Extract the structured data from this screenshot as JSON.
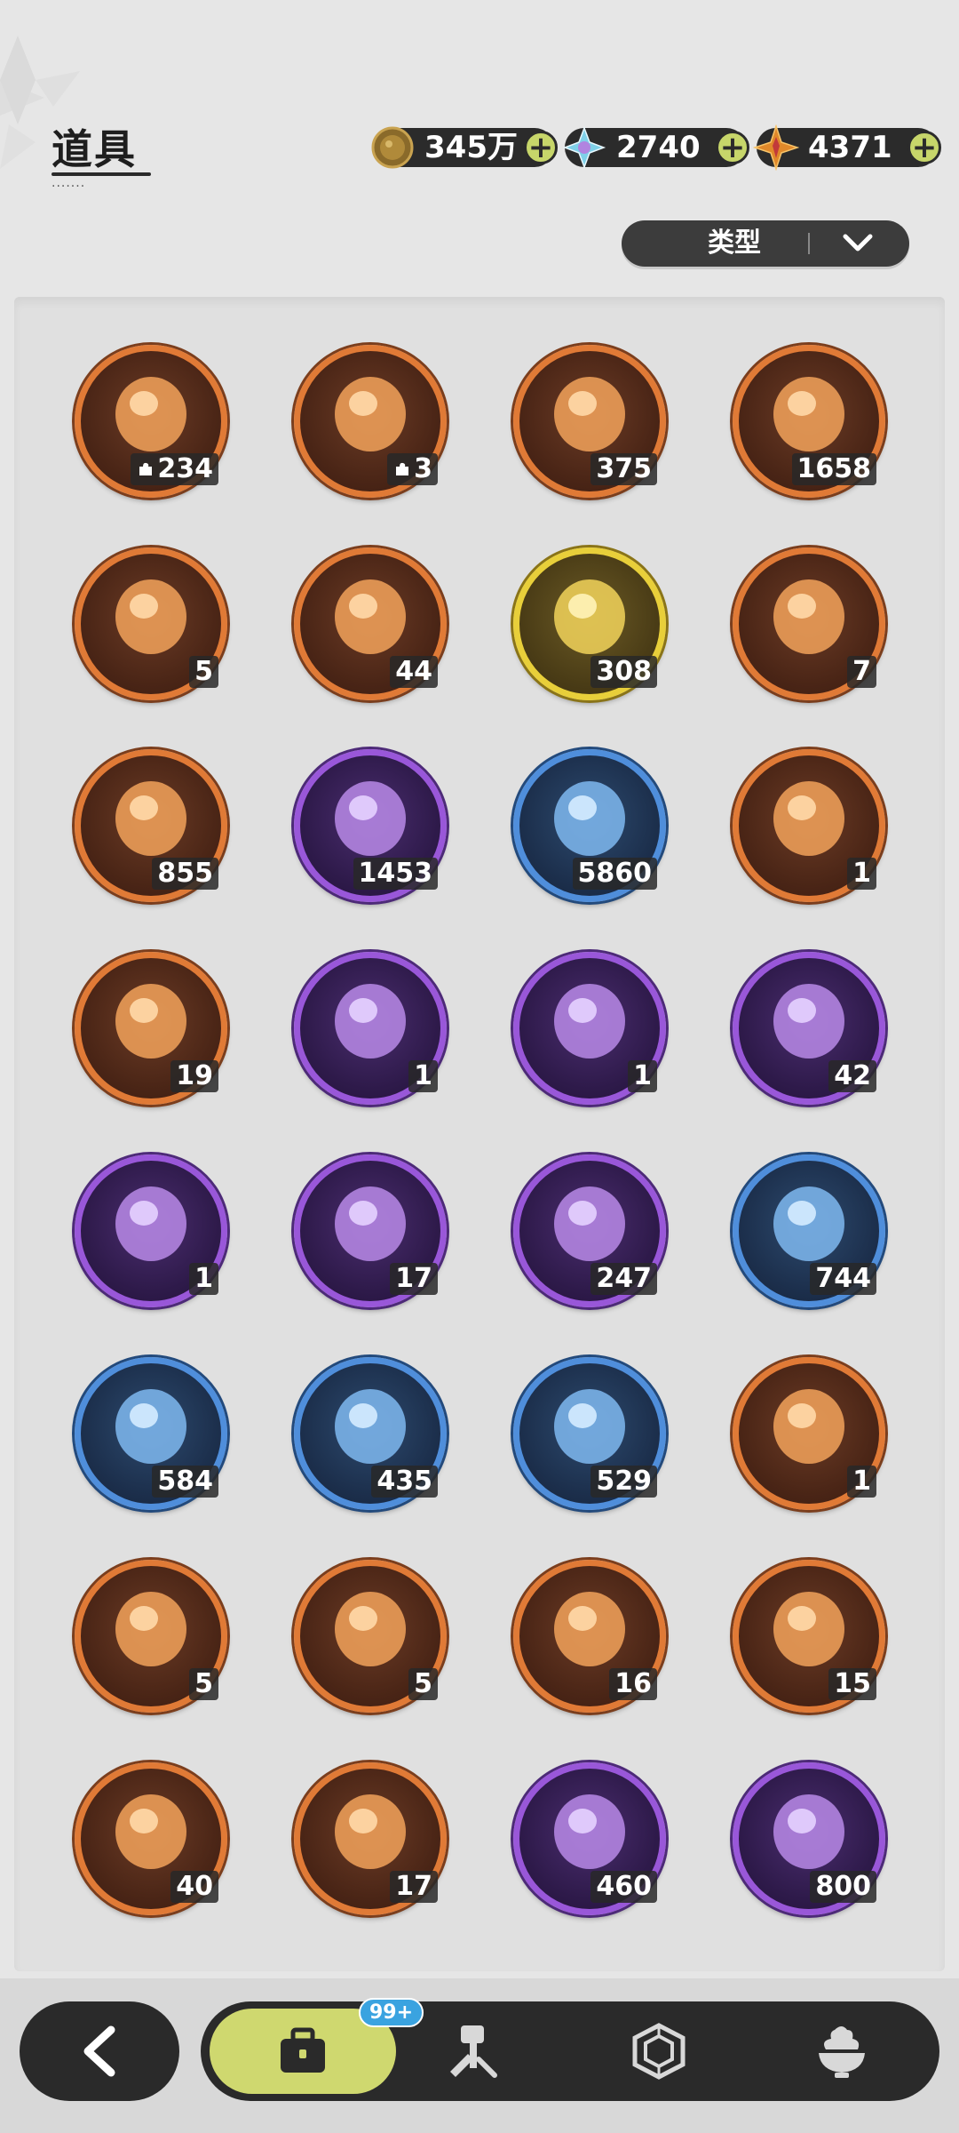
{
  "header": {
    "title": "道具",
    "title_dots": "·······"
  },
  "currencies": [
    {
      "icon": "gold-coin-icon",
      "value": "345万"
    },
    {
      "icon": "blue-crystal-icon",
      "value": "2740"
    },
    {
      "icon": "orange-star-gem-icon",
      "value": "4371"
    }
  ],
  "currency_plus_label": "+",
  "filter": {
    "type_label": "类型"
  },
  "items": [
    {
      "icon": "tiger-cub-shard-icon",
      "frame": "orange",
      "count": "234",
      "shard": true
    },
    {
      "icon": "tiger-shard-icon",
      "frame": "orange",
      "count": "3",
      "shard": true
    },
    {
      "icon": "purple-crystal-icon",
      "frame": "orange",
      "count": "375",
      "shard": false
    },
    {
      "icon": "blue-crystal-icon",
      "frame": "orange",
      "count": "1658",
      "shard": false
    },
    {
      "icon": "red-paw-charm-icon",
      "frame": "orange",
      "count": "5",
      "shard": false
    },
    {
      "icon": "gold-paw-charm-icon",
      "frame": "orange",
      "count": "44",
      "shard": false
    },
    {
      "icon": "gold-character-card-icon",
      "frame": "gold",
      "count": "308",
      "shard": false
    },
    {
      "icon": "rainbow-character-card-icon",
      "frame": "orange",
      "count": "7",
      "shard": false
    },
    {
      "icon": "orange-character-card-icon",
      "frame": "orange",
      "count": "855",
      "shard": false
    },
    {
      "icon": "purple-character-card-icon",
      "frame": "purple",
      "count": "1453",
      "shard": false
    },
    {
      "icon": "blue-character-card-icon",
      "frame": "blue",
      "count": "5860",
      "shard": false
    },
    {
      "icon": "exchange-card-icon",
      "frame": "orange",
      "count": "1",
      "shard": false
    },
    {
      "icon": "clover-ticket-icon",
      "frame": "orange",
      "count": "19",
      "shard": false
    },
    {
      "icon": "horn-ornament-icon",
      "frame": "purple",
      "count": "1",
      "shard": false
    },
    {
      "icon": "gift-box-icon",
      "frame": "purple",
      "count": "1",
      "shard": false
    },
    {
      "icon": "golden-helmet-icon",
      "frame": "purple",
      "count": "42",
      "shard": false
    },
    {
      "icon": "magic-mirror-icon",
      "frame": "purple",
      "count": "1",
      "shard": false
    },
    {
      "icon": "scroll-icon",
      "frame": "purple",
      "count": "17",
      "shard": false
    },
    {
      "icon": "peach-icon",
      "frame": "purple",
      "count": "247",
      "shard": false
    },
    {
      "icon": "shovel-icon",
      "frame": "blue",
      "count": "744",
      "shard": false
    },
    {
      "icon": "glove-icon",
      "frame": "blue",
      "count": "584",
      "shard": false
    },
    {
      "icon": "pickaxe-icon",
      "frame": "blue",
      "count": "435",
      "shard": false
    },
    {
      "icon": "hammer-icon",
      "frame": "blue",
      "count": "529",
      "shard": false
    },
    {
      "icon": "potion-icon",
      "frame": "orange",
      "count": "1",
      "shard": false
    },
    {
      "icon": "golden-key-icon",
      "frame": "orange",
      "count": "5",
      "shard": false
    },
    {
      "icon": "emblem-icon",
      "frame": "orange",
      "count": "5",
      "shard": false
    },
    {
      "icon": "ruby-heart-icon",
      "frame": "orange",
      "count": "16",
      "shard": false
    },
    {
      "icon": "shirt-token-icon",
      "frame": "orange",
      "count": "15",
      "shard": false
    },
    {
      "icon": "wheel-ticket-icon",
      "frame": "orange",
      "count": "40",
      "shard": false
    },
    {
      "icon": "rainbow-ticket-icon",
      "frame": "orange",
      "count": "17",
      "shard": false
    },
    {
      "icon": "gold-coin-icon",
      "frame": "purple",
      "count": "460",
      "shard": false
    },
    {
      "icon": "trophy-medal-icon",
      "frame": "purple",
      "count": "800",
      "shard": false
    }
  ],
  "nav": {
    "back_icon": "back-arrow-icon",
    "badge": "99+",
    "tabs": [
      {
        "icon": "bag-icon",
        "active": true
      },
      {
        "icon": "hammer-tools-icon",
        "active": false
      },
      {
        "icon": "hexagon-gem-icon",
        "active": false
      },
      {
        "icon": "cream-bowl-icon",
        "active": false
      }
    ]
  },
  "colors": {
    "accent": "#cfd86f",
    "frame_orange": "#e07a36",
    "frame_purple": "#9957d9",
    "frame_blue": "#4f8edb",
    "frame_gold": "#e8cf3a",
    "badge": "#3aa3e0"
  }
}
